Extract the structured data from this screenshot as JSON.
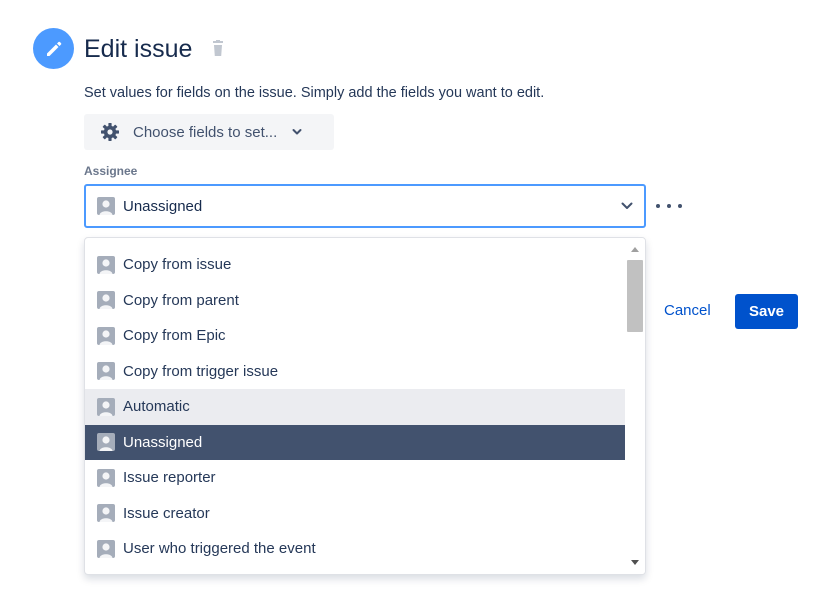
{
  "header": {
    "title": "Edit issue",
    "description": "Set values for fields on the issue. Simply add the fields you want to edit."
  },
  "choose_fields": {
    "label": "Choose fields to set..."
  },
  "assignee": {
    "label": "Assignee",
    "value": "Unassigned"
  },
  "dropdown": {
    "items": [
      {
        "label": "Copy from issue"
      },
      {
        "label": "Copy from parent"
      },
      {
        "label": "Copy from Epic"
      },
      {
        "label": "Copy from trigger issue"
      },
      {
        "label": "Automatic",
        "state": "hover"
      },
      {
        "label": "Unassigned",
        "state": "selected"
      },
      {
        "label": "Issue reporter"
      },
      {
        "label": "Issue creator"
      },
      {
        "label": "User who triggered the event"
      }
    ]
  },
  "actions": {
    "cancel": "Cancel",
    "save": "Save"
  },
  "colors": {
    "accent": "#0052cc",
    "focus_border": "#4c9aff",
    "selected_bg": "#42526e",
    "hover_bg": "#ebecf0"
  },
  "icons": [
    "pencil-icon",
    "trash-icon",
    "gear-icon",
    "chevron-down-icon",
    "avatar-icon",
    "more-icon"
  ]
}
